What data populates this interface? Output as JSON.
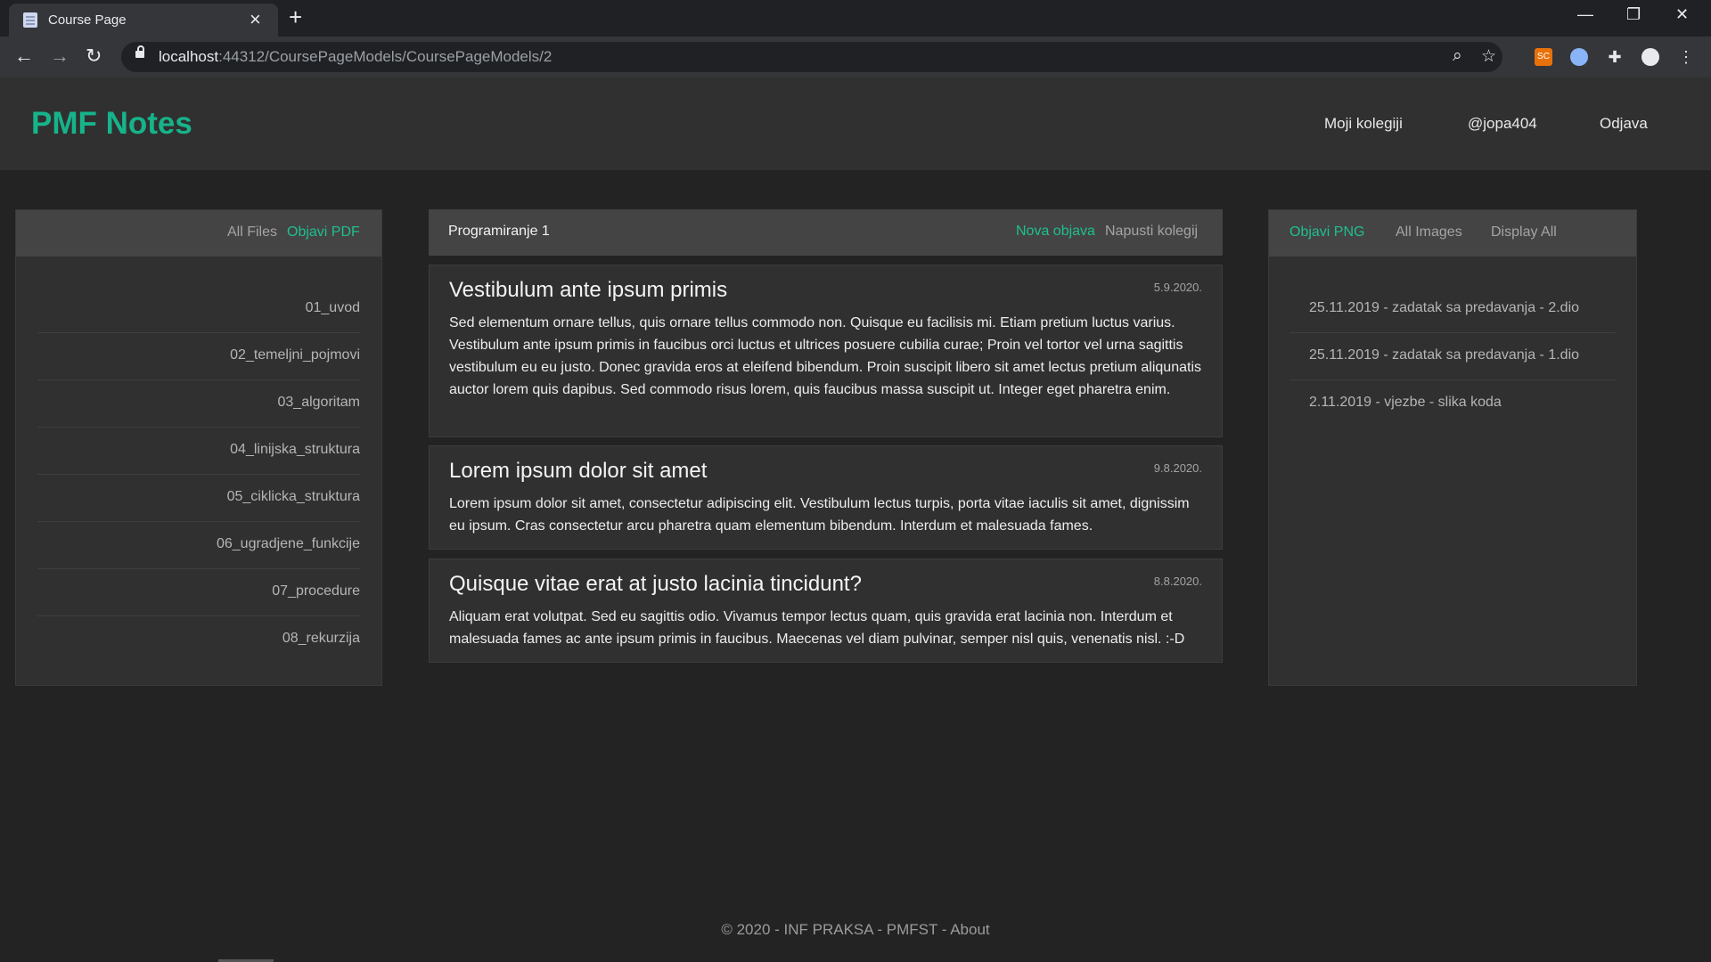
{
  "browser": {
    "tab_title": "Course Page",
    "url_host": "localhost",
    "url_path": ":44312/CoursePageModels/CoursePageModels/2",
    "extension_label": "SC"
  },
  "site": {
    "brand": "PMF Notes",
    "nav": [
      "Moji kolegiji",
      "@jopa404",
      "Odjava"
    ],
    "accent_color": "#17b38a"
  },
  "files_panel": {
    "link_all": "All Files",
    "link_publish": "Objavi PDF",
    "files": [
      "01_uvod",
      "02_temeljni_pojmovi",
      "03_algoritam",
      "04_linijska_struktura",
      "05_ciklicka_struktura",
      "06_ugradjene_funkcije",
      "07_procedure",
      "08_rekurzija"
    ]
  },
  "course": {
    "title": "Programiranje 1",
    "new_post": "Nova objava",
    "leave": "Napusti kolegij",
    "posts": [
      {
        "title": "Vestibulum ante ipsum primis",
        "date": "5.9.2020.",
        "body": "Sed elementum ornare tellus, quis ornare tellus commodo non. Quisque eu facilisis mi. Etiam pretium luctus varius. Vestibulum ante ipsum primis in faucibus orci luctus et ultrices posuere cubilia curae; Proin vel tortor vel urna sagittis vestibulum eu eu justo. Donec gravida eros at eleifend bibendum. Proin suscipit libero sit amet lectus pretium aliqunatis auctor lorem quis dapibus. Sed commodo risus lorem, quis faucibus massa suscipit ut. Integer eget pharetra enim."
      },
      {
        "title": "Lorem ipsum dolor sit amet",
        "date": "9.8.2020.",
        "body": "Lorem ipsum dolor sit amet, consectetur adipiscing elit. Vestibulum lectus turpis, porta vitae iaculis sit amet, dignissim eu ipsum. Cras consectetur arcu pharetra quam elementum bibendum. Interdum et malesuada fames."
      },
      {
        "title": "Quisque vitae erat at justo lacinia tincidunt?",
        "date": "8.8.2020.",
        "body": "Aliquam erat volutpat. Sed eu sagittis odio. Vivamus tempor lectus quam, quis gravida erat lacinia non. Interdum et malesuada fames ac ante ipsum primis in faucibus. Maecenas vel diam pulvinar, semper nisl quis, venenatis nisl. :-D"
      }
    ]
  },
  "images_panel": {
    "link_publish": "Objavi PNG",
    "link_all": "All Images",
    "link_display": "Display All",
    "images": [
      "25.11.2019 - zadatak sa predavanja - 2.dio",
      "25.11.2019 - zadatak sa predavanja - 1.dio",
      "2.11.2019 - vjezbe - slika koda"
    ]
  },
  "footer": "© 2020 - INF PRAKSA - PMFST - About"
}
